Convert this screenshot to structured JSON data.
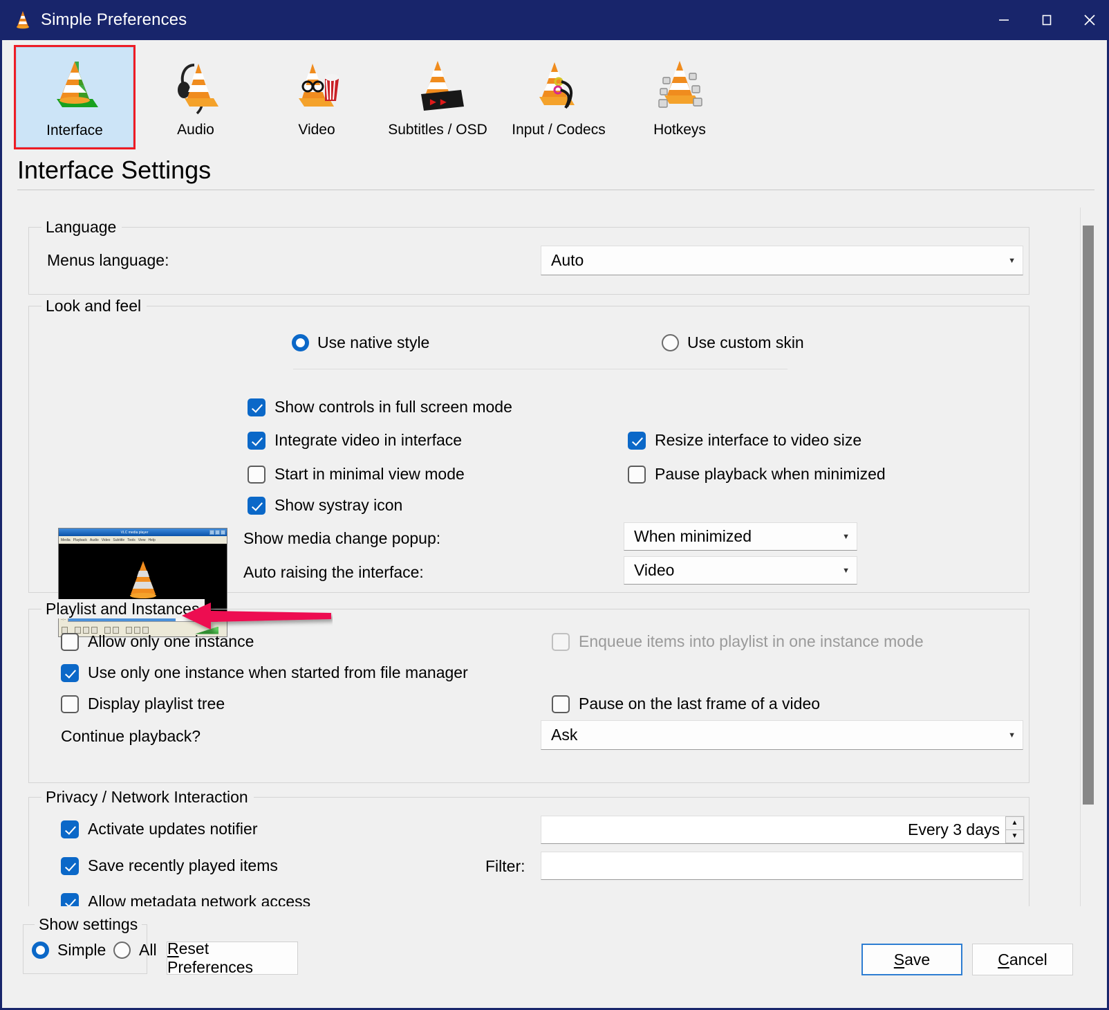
{
  "window": {
    "title": "Simple Preferences",
    "minimize_label": "Minimize",
    "maximize_label": "Maximize",
    "close_label": "Close"
  },
  "toolbar": {
    "items": [
      {
        "label": "Interface",
        "icon": "vlc-cone-icon",
        "selected": true
      },
      {
        "label": "Audio",
        "icon": "vlc-headphones-icon",
        "selected": false
      },
      {
        "label": "Video",
        "icon": "vlc-film-icon",
        "selected": false
      },
      {
        "label": "Subtitles / OSD",
        "icon": "vlc-subtitles-icon",
        "selected": false
      },
      {
        "label": "Input / Codecs",
        "icon": "vlc-cables-icon",
        "selected": false
      },
      {
        "label": "Hotkeys",
        "icon": "vlc-keys-icon",
        "selected": false
      }
    ]
  },
  "page": {
    "title": "Interface Settings"
  },
  "language_group": {
    "legend": "Language",
    "menus_language_label": "Menus language:",
    "menus_language_value": "Auto"
  },
  "look_group": {
    "legend": "Look and feel",
    "style_native_label": "Use native style",
    "style_native_checked": true,
    "style_custom_label": "Use custom skin",
    "style_custom_checked": false,
    "checkboxes": [
      {
        "label": "Show controls in full screen mode",
        "checked": true
      },
      {
        "label": "Integrate video in interface",
        "checked": true
      },
      {
        "label": "Start in minimal view mode",
        "checked": false
      },
      {
        "label": "Show systray icon",
        "checked": true
      },
      {
        "label": "Resize interface to video size",
        "checked": true
      },
      {
        "label": "Pause playback when minimized",
        "checked": false
      }
    ],
    "media_popup_label": "Show media change popup:",
    "media_popup_value": "When minimized",
    "auto_raise_label": "Auto raising the interface:",
    "auto_raise_value": "Video",
    "preview": {
      "window_title": "VLC media player",
      "menu_items": [
        "Media",
        "Playback",
        "Audio",
        "Video",
        "Subtitle",
        "Tools",
        "View",
        "Help"
      ],
      "time_elapsed": "--:--",
      "time_total": "--:--"
    }
  },
  "playlist_group": {
    "legend": "Playlist and Instances",
    "checkboxes": [
      {
        "label": "Allow only one instance",
        "checked": false,
        "disabled": false
      },
      {
        "label": "Use only one instance when started from file manager",
        "checked": true,
        "disabled": false
      },
      {
        "label": "Display playlist tree",
        "checked": false,
        "disabled": false
      },
      {
        "label": "Enqueue items into playlist in one instance mode",
        "checked": false,
        "disabled": true
      },
      {
        "label": "Pause on the last frame of a video",
        "checked": false,
        "disabled": false
      }
    ],
    "continue_playback_label": "Continue playback?",
    "continue_playback_value": "Ask"
  },
  "privacy_group": {
    "legend": "Privacy / Network Interaction",
    "checkboxes": [
      {
        "label": "Activate updates notifier",
        "checked": true
      },
      {
        "label": "Save recently played items",
        "checked": true
      },
      {
        "label": "Allow metadata network access",
        "checked": true
      }
    ],
    "update_interval_value": "Every 3 days",
    "filter_label": "Filter:",
    "filter_value": ""
  },
  "bottom": {
    "show_settings_legend": "Show settings",
    "simple_label": "Simple",
    "simple_checked": true,
    "all_label": "All",
    "all_checked": false,
    "reset_label": "Reset Preferences",
    "reset_mnemonic": "R",
    "save_label": "Save",
    "save_mnemonic": "S",
    "cancel_label": "Cancel",
    "cancel_mnemonic": "C"
  },
  "annotation": {
    "arrow_color": "#ED0F51",
    "points_at": "Playlist and Instances"
  },
  "colors": {
    "titlebar": "#18256b",
    "accent_blue": "#0b68c8",
    "selected_tab_bg": "#cce4f7",
    "selection_outline": "#ee1c25",
    "window_bg": "#f0f0f0"
  }
}
